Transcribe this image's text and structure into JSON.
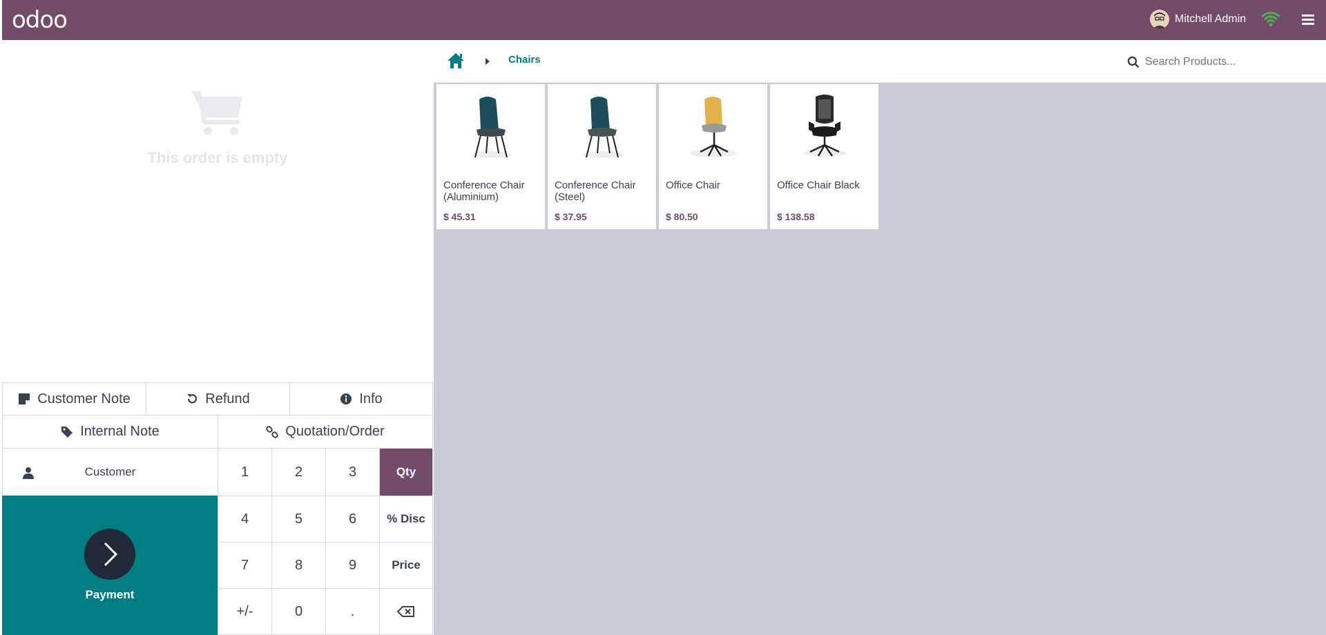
{
  "header": {
    "logo": "odoo",
    "user_name": "Mitchell Admin"
  },
  "order": {
    "empty_text": "This order is empty"
  },
  "actions": {
    "customer_note": "Customer Note",
    "refund": "Refund",
    "info": "Info",
    "internal_note": "Internal Note",
    "quotation_order": "Quotation/Order",
    "customer": "Customer",
    "payment": "Payment"
  },
  "numpad": {
    "keys": [
      "1",
      "2",
      "3",
      "Qty",
      "4",
      "5",
      "6",
      "% Disc",
      "7",
      "8",
      "9",
      "Price",
      "+/-",
      "0",
      "."
    ]
  },
  "breadcrumb": {
    "current": "Chairs"
  },
  "search": {
    "placeholder": "Search Products..."
  },
  "products": [
    {
      "name": "Conference Chair (Aluminium)",
      "price": "$ 45.31"
    },
    {
      "name": "Conference Chair (Steel)",
      "price": "$ 37.95"
    },
    {
      "name": "Office Chair",
      "price": "$ 80.50"
    },
    {
      "name": "Office Chair Black",
      "price": "$ 138.58"
    }
  ],
  "colors": {
    "brand": "#714B67",
    "accent": "#017E84"
  }
}
